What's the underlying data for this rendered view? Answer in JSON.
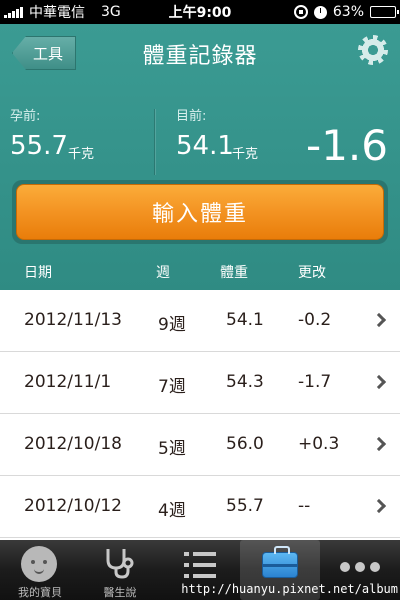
{
  "status_bar": {
    "carrier": "中華電信",
    "network": "3G",
    "time": "上午9:00",
    "battery_percent": "63%",
    "battery_level": 0.63
  },
  "nav": {
    "back_label": "工具",
    "title": "體重記錄器",
    "settings_icon": "gear-icon"
  },
  "stats": {
    "pre_label": "孕前:",
    "pre_value": "55.7",
    "pre_unit": "千克",
    "current_label": "目前:",
    "current_value": "54.1",
    "current_unit": "千克",
    "difference": "-1.6"
  },
  "input_button_label": "輸入體重",
  "table": {
    "columns": [
      "日期",
      "週",
      "體重",
      "更改"
    ],
    "rows": [
      {
        "date": "2012/11/13",
        "week": "9週",
        "weight": "54.1",
        "change": "-0.2"
      },
      {
        "date": "2012/11/1",
        "week": "7週",
        "weight": "54.3",
        "change": "-1.7"
      },
      {
        "date": "2012/10/18",
        "week": "5週",
        "weight": "56.0",
        "change": "+0.3"
      },
      {
        "date": "2012/10/12",
        "week": "4週",
        "weight": "55.7",
        "change": "--"
      }
    ]
  },
  "tabs": [
    {
      "label": "我的寶貝",
      "icon": "baby-icon"
    },
    {
      "label": "醫生說",
      "icon": "stethoscope-icon"
    },
    {
      "label": "",
      "icon": "list-icon"
    },
    {
      "label": "",
      "icon": "toolbox-icon",
      "active": true
    },
    {
      "label": "",
      "icon": "more-icon"
    }
  ],
  "watermark": "http://huanyu.pixnet.net/album",
  "colors": {
    "header_teal": "#3b9b93",
    "button_orange": "#f39322",
    "tabbar_dark": "#1c1c1c"
  }
}
